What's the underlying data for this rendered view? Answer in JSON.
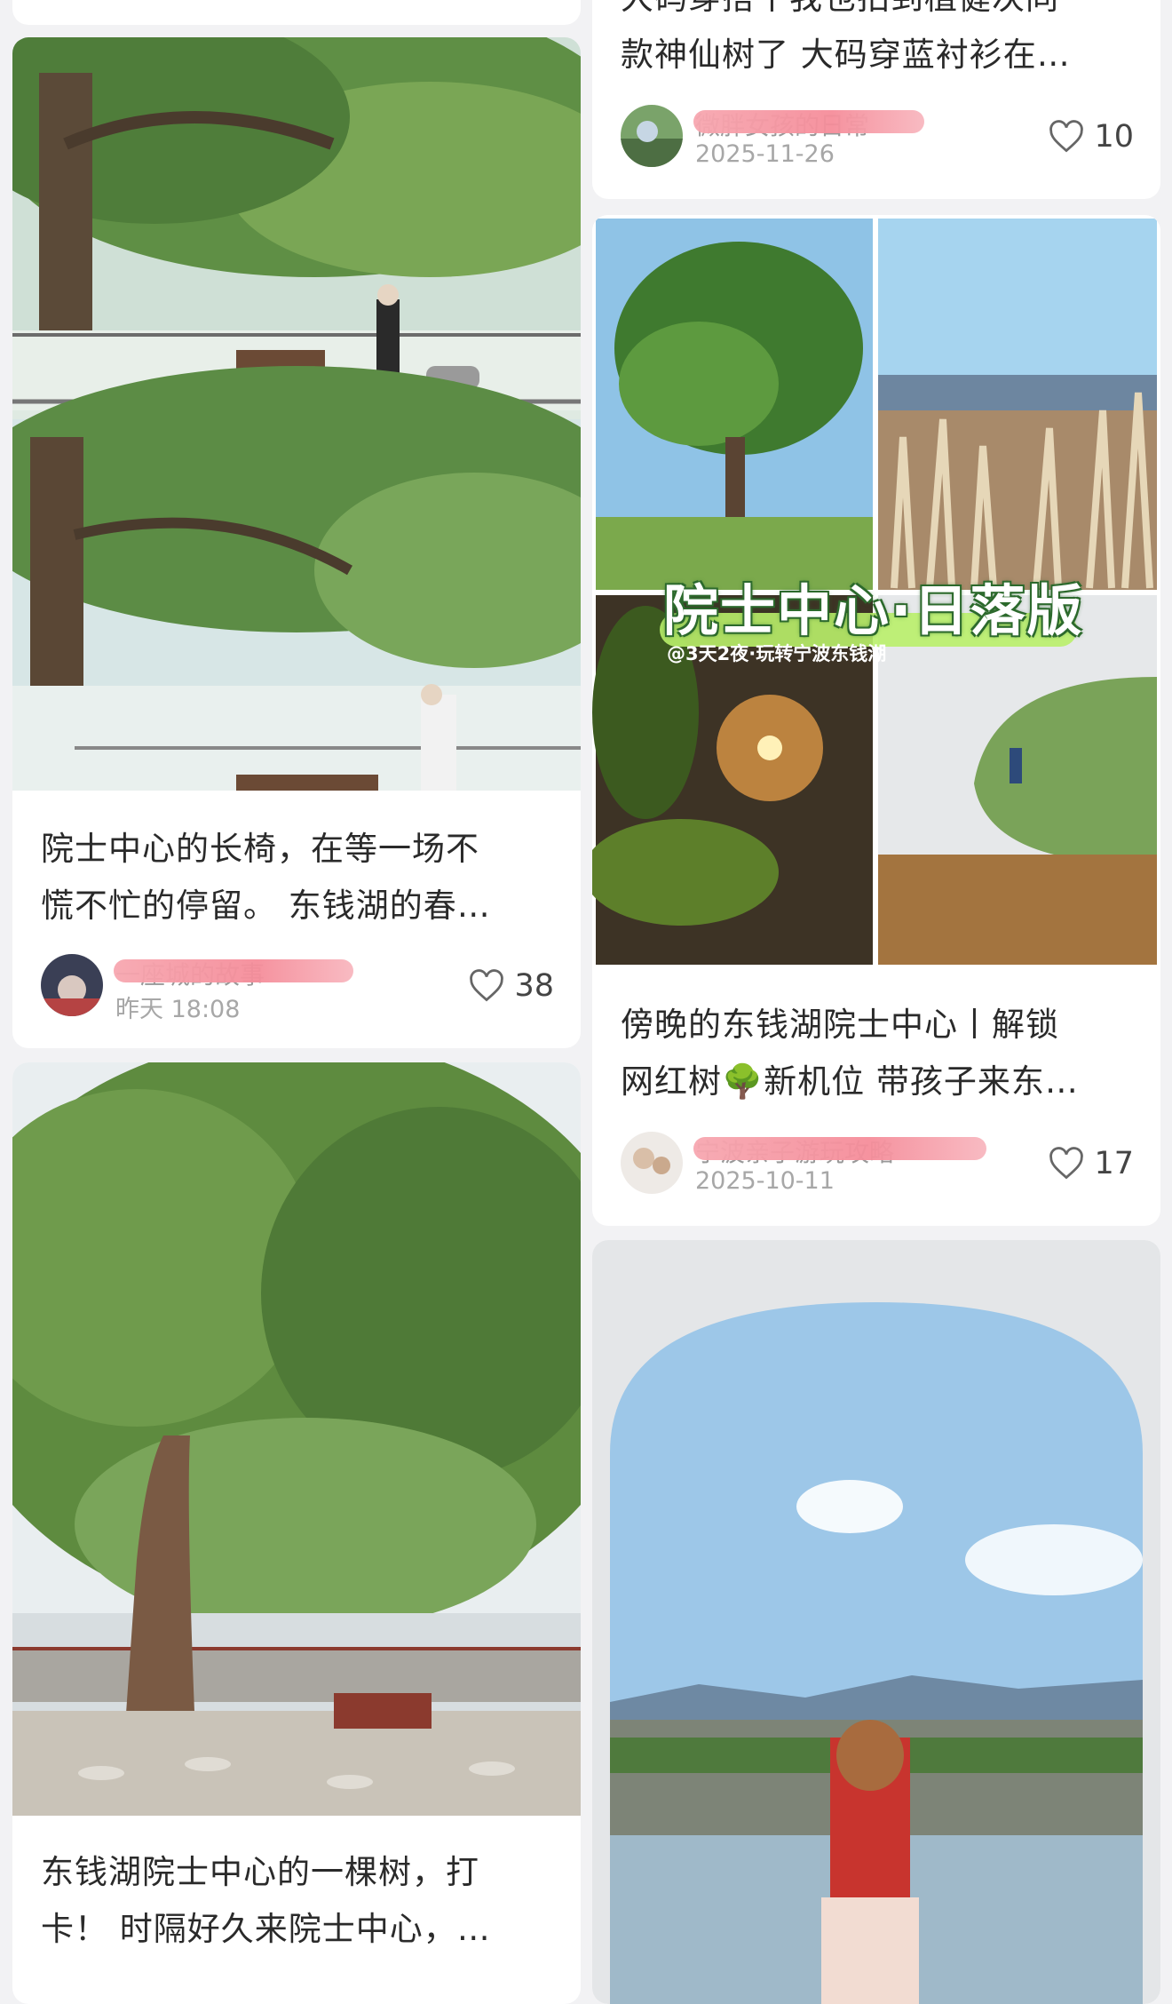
{
  "feed": {
    "left": [
      {
        "title_lines": [
          "院士中心的长椅，在等一场不",
          "慌不忙的停留。 东钱湖的春…"
        ],
        "author": "一座城的故事",
        "date": "昨天 18:08",
        "likes": "38"
      },
      {
        "title_lines": [
          "东钱湖院士中心的一棵树，打",
          "卡！ 时隔好久来院士中心，…"
        ]
      }
    ],
    "right": [
      {
        "title_lines": [
          "大码穿搭丨我也拍到植健次同",
          "款神仙树了 大码穿蓝衬衫在…"
        ],
        "author": "微胖女孩的日常",
        "date": "2025-11-26",
        "likes": "10"
      },
      {
        "overlay_title": "院士中心·日落版",
        "overlay_subtitle": "@3天2夜·玩转宁波东钱湖",
        "title_lines": [
          "傍晚的东钱湖院士中心丨解锁",
          "网红树🌳新机位 带孩子来东…"
        ],
        "author": "宁波亲子游玩攻略",
        "date": "2025-10-11",
        "likes": "17"
      },
      {}
    ]
  },
  "icons": {
    "like": "heart-outline-icon"
  },
  "colors": {
    "page_bg": "#f2f2f4",
    "card_bg": "#ffffff",
    "redaction": "#f58d9a",
    "overlay_highlight": "#b9ef6a"
  }
}
